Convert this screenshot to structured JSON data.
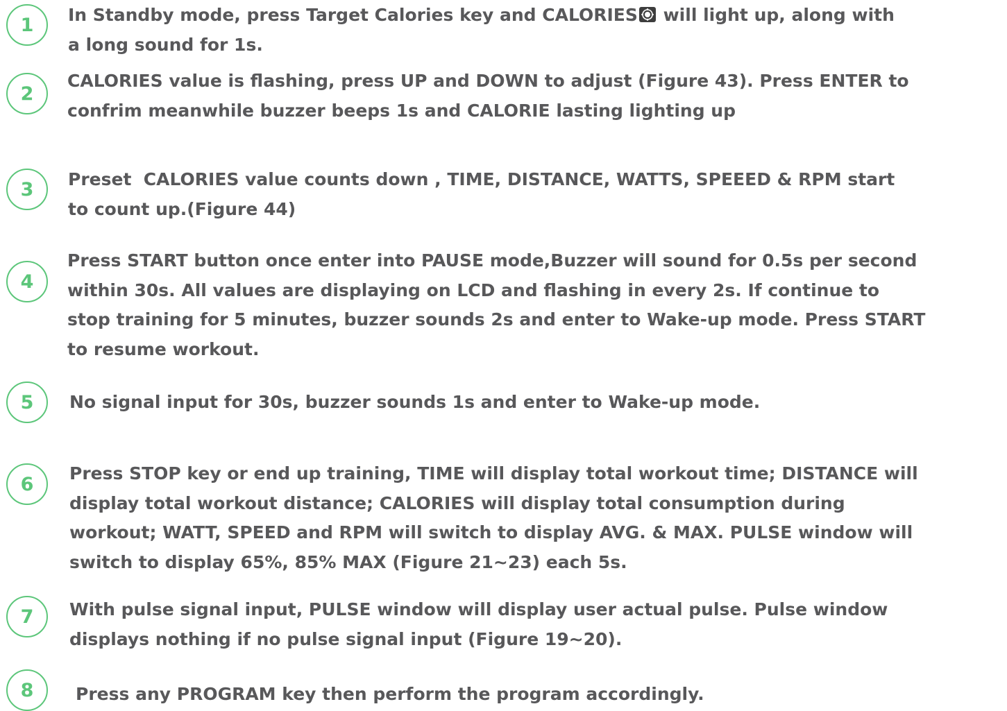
{
  "colors": {
    "accent": "#5cc67a",
    "text": "#58585a"
  },
  "steps": [
    {
      "number": "1",
      "lines": [
        "In Standby mode, press Target Calories key and CALORIES",
        " will light up, along with",
        "a long sound for 1s."
      ],
      "icon": "calories-target-icon"
    },
    {
      "number": "2",
      "lines": [
        "CALORIES value is flashing, press UP and DOWN to adjust (Figure 43). Press ENTER to",
        "confrim meanwhile buzzer beeps 1s and CALORIE lasting lighting up"
      ]
    },
    {
      "number": "3",
      "lines": [
        "Preset  CALORIES value counts down , TIME, DISTANCE, WATTS, SPEEED & RPM start",
        "to count up.(Figure 44)"
      ]
    },
    {
      "number": "4",
      "lines": [
        "Press START button once enter into PAUSE mode,Buzzer will sound for 0.5s per second",
        "within 30s. All values are displaying on LCD and flashing in every 2s. If continue to",
        "stop training for 5 minutes, buzzer sounds 2s and enter to Wake-up mode. Press START",
        "to resume workout."
      ]
    },
    {
      "number": "5",
      "lines": [
        "No signal input for 30s, buzzer sounds 1s and enter to Wake-up mode."
      ]
    },
    {
      "number": "6",
      "lines": [
        "Press STOP key or end up training, TIME will display total workout time; DISTANCE will",
        "display total workout distance; CALORIES will display total consumption during",
        "workout; WATT, SPEED and RPM will switch to display AVG. & MAX. PULSE window will",
        "switch to display 65%, 85% MAX (Figure 21~23) each 5s."
      ]
    },
    {
      "number": "7",
      "lines": [
        "With pulse signal input, PULSE window will display user actual pulse. Pulse window",
        "displays nothing if no pulse signal input (Figure 19~20)."
      ]
    },
    {
      "number": "8",
      "lines": [
        "Press any PROGRAM key then perform the program accordingly."
      ]
    }
  ]
}
